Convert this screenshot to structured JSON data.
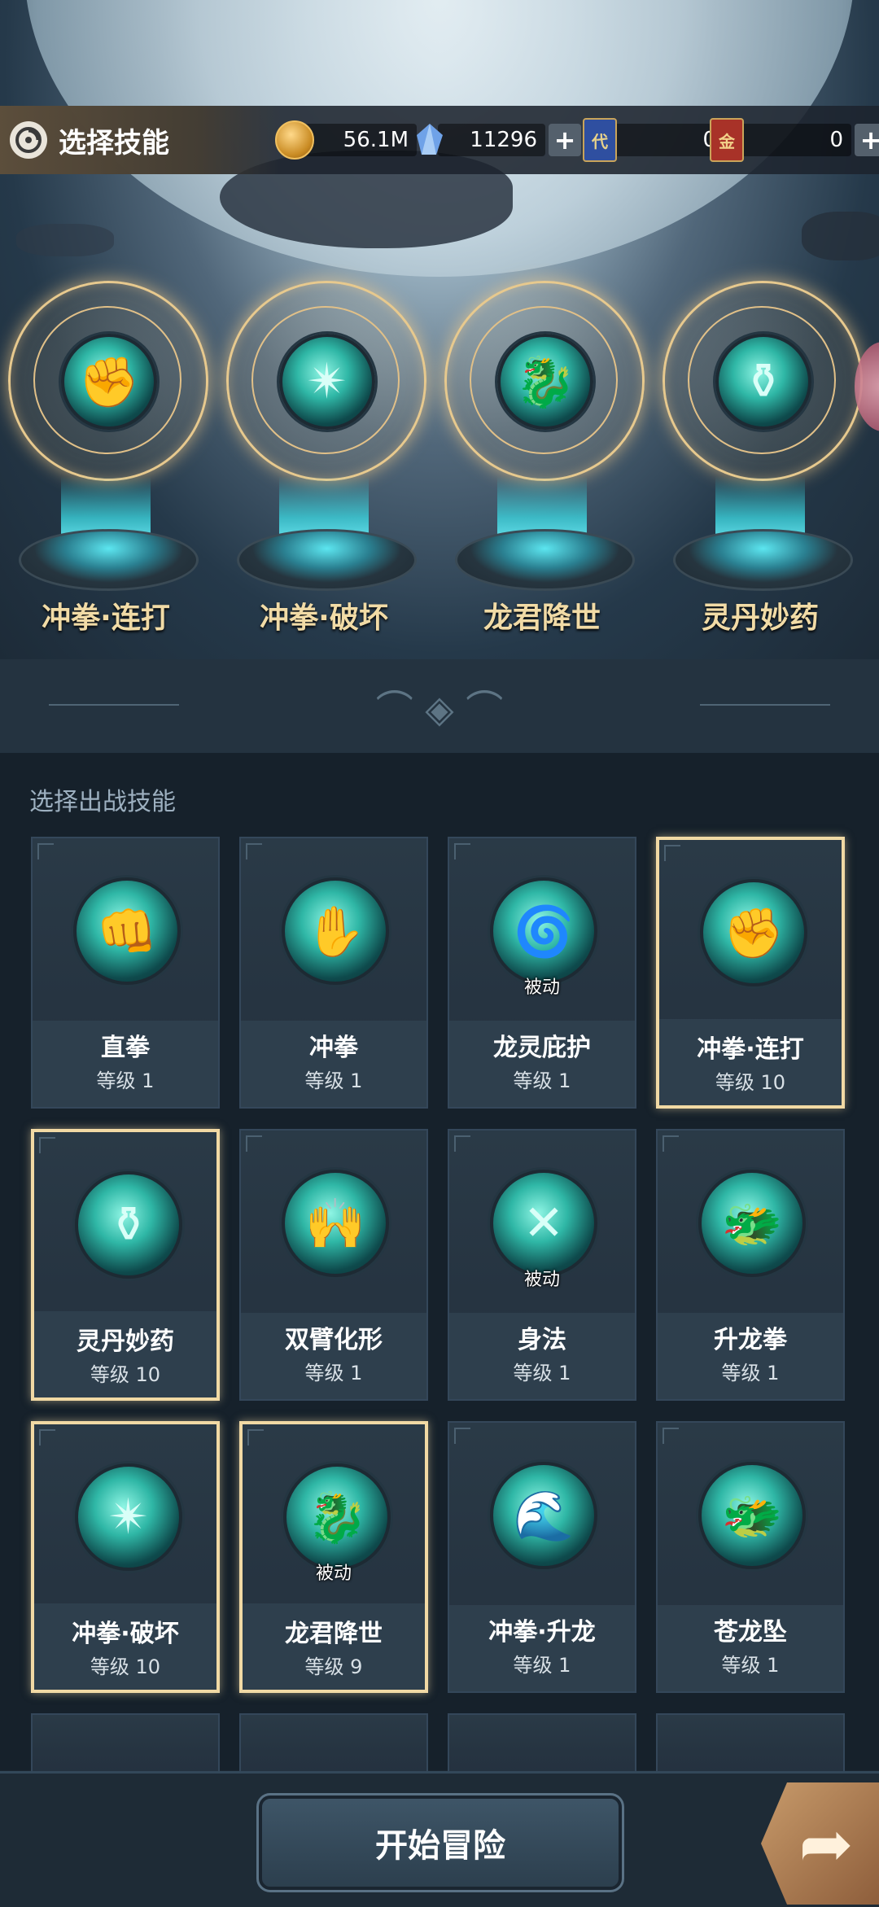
{
  "header": {
    "title": "选择技能",
    "gold": "56.1M",
    "crystals": "11296",
    "ticket_a": "0",
    "ticket_b": "0",
    "ticket_a_mark": "代",
    "ticket_b_mark": "金",
    "plus": "+"
  },
  "equipped": [
    {
      "name": "冲拳·连打",
      "icon": "fist-icon"
    },
    {
      "name": "冲拳·破坏",
      "icon": "burst-icon"
    },
    {
      "name": "龙君降世",
      "icon": "dragon-icon"
    },
    {
      "name": "灵丹妙药",
      "icon": "gourd-icon"
    }
  ],
  "section_label": "选择出战技能",
  "passive_label": "被动",
  "skills": [
    {
      "name": "直拳",
      "level": "等级 1",
      "selected": false,
      "passive": false
    },
    {
      "name": "冲拳",
      "level": "等级 1",
      "selected": false,
      "passive": false
    },
    {
      "name": "龙灵庇护",
      "level": "等级 1",
      "selected": false,
      "passive": true
    },
    {
      "name": "冲拳·连打",
      "level": "等级 10",
      "selected": true,
      "passive": false
    },
    {
      "name": "灵丹妙药",
      "level": "等级 10",
      "selected": true,
      "passive": false
    },
    {
      "name": "双臂化形",
      "level": "等级 1",
      "selected": false,
      "passive": false
    },
    {
      "name": "身法",
      "level": "等级 1",
      "selected": false,
      "passive": true
    },
    {
      "name": "升龙拳",
      "level": "等级 1",
      "selected": false,
      "passive": false
    },
    {
      "name": "冲拳·破坏",
      "level": "等级 10",
      "selected": true,
      "passive": false
    },
    {
      "name": "龙君降世",
      "level": "等级 9",
      "selected": true,
      "passive": true
    },
    {
      "name": "冲拳·升龙",
      "level": "等级 1",
      "selected": false,
      "passive": false
    },
    {
      "name": "苍龙坠",
      "level": "等级 1",
      "selected": false,
      "passive": false
    }
  ],
  "footer": {
    "start_label": "开始冒险"
  },
  "colors": {
    "accent_gold": "#f1d9a4",
    "skill_teal": "#2fb7a6",
    "panel": "#16212b"
  }
}
